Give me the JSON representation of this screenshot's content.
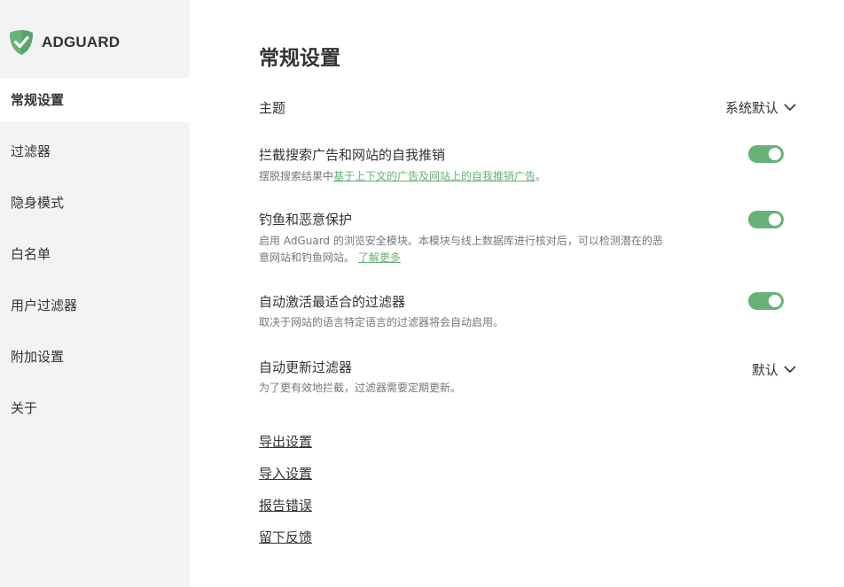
{
  "app": {
    "brand": "ADGUARD",
    "accent_color": "#67b279",
    "logo_icon": "shield-check-icon"
  },
  "sidebar": {
    "items": [
      {
        "label": "常规设置",
        "active": true
      },
      {
        "label": "过滤器",
        "active": false
      },
      {
        "label": "隐身模式",
        "active": false
      },
      {
        "label": "白名单",
        "active": false
      },
      {
        "label": "用户过滤器",
        "active": false
      },
      {
        "label": "附加设置",
        "active": false
      },
      {
        "label": "关于",
        "active": false
      }
    ]
  },
  "main": {
    "title": "常规设置",
    "theme": {
      "label": "主题",
      "value": "系统默认"
    },
    "search_ads": {
      "title": "拦截搜索广告和网站的自我推销",
      "desc_prefix": "摆脱搜索结果中",
      "desc_link": "基于上下文的广告及网站上的自我推销广告",
      "desc_suffix": "。",
      "enabled": true
    },
    "phishing": {
      "title": "钓鱼和恶意保护",
      "desc": "启用 AdGuard 的浏览安全模块。本模块与线上数据库进行核对后，可以检测潜在的恶意网站和钓鱼网站。",
      "link": "了解更多",
      "enabled": true
    },
    "auto_filters": {
      "title": "自动激活最适合的过滤器",
      "desc": "取决于网站的语言特定语言的过滤器将会自动启用。",
      "enabled": true
    },
    "auto_update": {
      "title": "自动更新过滤器",
      "desc": "为了更有效地拦截，过滤器需要定期更新。",
      "value": "默认"
    },
    "actions": {
      "export": "导出设置",
      "import": "导入设置",
      "report": "报告错误",
      "feedback": "留下反馈"
    }
  }
}
